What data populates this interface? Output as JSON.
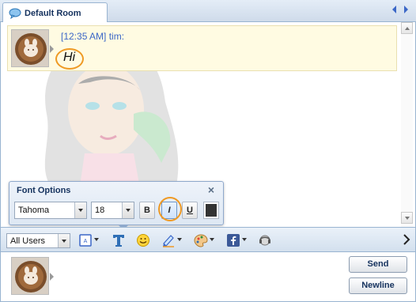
{
  "room_tab": {
    "title": "Default Room",
    "icon": "speech-bubble-icon"
  },
  "navigation": {
    "prev_icon": "triangle-left-icon",
    "next_icon": "triangle-right-icon"
  },
  "messages": [
    {
      "timestamp": "[12:35 AM]",
      "user": "tim:",
      "text": "Hi",
      "avatar": "latte-art-avatar"
    }
  ],
  "font_options": {
    "title": "Font Options",
    "close_label": "×",
    "font_family": "Tahoma",
    "font_size": "18",
    "bold_label": "B",
    "italic_label": "I",
    "underline_label": "U",
    "italic_active": true,
    "text_color": "#333333"
  },
  "toolbar": {
    "recipient": "All Users",
    "items": [
      "emoticon-box-icon",
      "font-t-icon",
      "smiley-icon",
      "highlighter-icon",
      "palette-icon",
      "facebook-icon",
      "headset-icon"
    ],
    "more_icon": "chevron-right-icon"
  },
  "compose": {
    "send_label": "Send",
    "newline_label": "Newline"
  },
  "colors": {
    "accent": "#3b67c7",
    "highlight": "#ef9a24",
    "message_bg": "#fffbe2",
    "border": "#99b4d1"
  }
}
